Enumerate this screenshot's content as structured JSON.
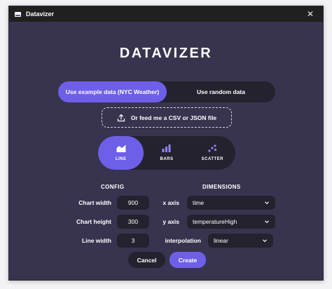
{
  "window": {
    "title": "Datavizer",
    "close_glyph": "✕"
  },
  "logo": "DATAVIZER",
  "data_source": {
    "example_label": "Use example data (NYC Weather)",
    "random_label": "Use random data",
    "file_label": "Or feed me a CSV or JSON file"
  },
  "chart_types": [
    {
      "label": "LINE",
      "icon": "line-chart-icon",
      "active": true
    },
    {
      "label": "BARS",
      "icon": "bar-chart-icon",
      "active": false
    },
    {
      "label": "SCATTER",
      "icon": "scatter-chart-icon",
      "active": false
    }
  ],
  "config": {
    "title": "CONFIG",
    "chart_width_label": "Chart width",
    "chart_width_value": "900",
    "chart_height_label": "Chart height",
    "chart_height_value": "300",
    "line_width_label": "Line width",
    "line_width_value": "3"
  },
  "dimensions": {
    "title": "DIMENSIONS",
    "x_axis_label": "x axis",
    "x_axis_value": "time",
    "y_axis_label": "y axis",
    "y_axis_value": "temperatureHigh",
    "interpolation_label": "interpolation",
    "interpolation_value": "linear"
  },
  "actions": {
    "cancel_label": "Cancel",
    "create_label": "Create"
  },
  "colors": {
    "accent": "#6e5fe8",
    "background": "#38344f",
    "control": "#24222e",
    "titlebar": "#202020"
  }
}
